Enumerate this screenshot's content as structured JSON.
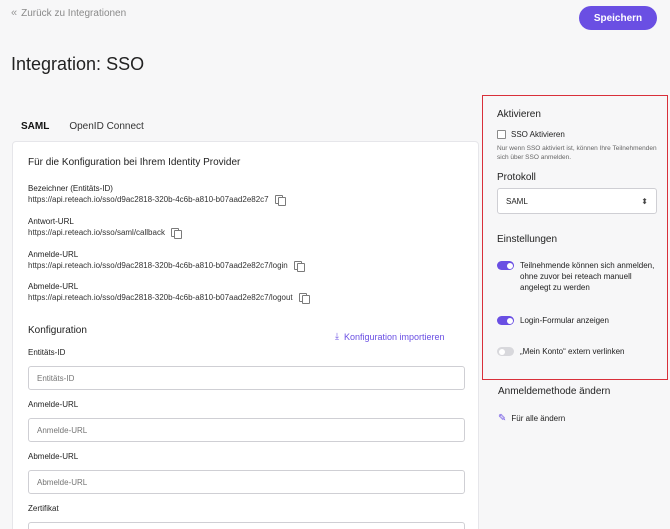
{
  "header": {
    "back_label": "Zurück zu Integrationen",
    "save_label": "Speichern",
    "title": "Integration: SSO"
  },
  "tabs": [
    {
      "label": "SAML",
      "active": true
    },
    {
      "label": "OpenID Connect",
      "active": false
    }
  ],
  "idp": {
    "heading": "Für die Konfiguration bei Ihrem Identity Provider",
    "items": [
      {
        "label": "Bezeichner (Entitäts-ID)",
        "value": "https://api.reteach.io/sso/d9ac2818-320b-4c6b-a810-b07aad2e82c7"
      },
      {
        "label": "Antwort-URL",
        "value": "https://api.reteach.io/sso/saml/callback"
      },
      {
        "label": "Anmelde-URL",
        "value": "https://api.reteach.io/sso/d9ac2818-320b-4c6b-a810-b07aad2e82c7/login"
      },
      {
        "label": "Abmelde-URL",
        "value": "https://api.reteach.io/sso/d9ac2818-320b-4c6b-a810-b07aad2e82c7/logout"
      }
    ]
  },
  "config": {
    "heading": "Konfiguration",
    "import_label": "Konfiguration importieren",
    "fields": [
      {
        "label": "Entitäts-ID",
        "placeholder": "Entitäts-ID",
        "value": ""
      },
      {
        "label": "Anmelde-URL",
        "placeholder": "Anmelde-URL",
        "value": ""
      },
      {
        "label": "Abmelde-URL",
        "placeholder": "Abmelde-URL",
        "value": ""
      },
      {
        "label": "Zertifikat",
        "placeholder": "",
        "value": ""
      }
    ]
  },
  "sidebar": {
    "activate_heading": "Aktivieren",
    "sso_checkbox_label": "SSO Aktivieren",
    "sso_checkbox_checked": false,
    "sso_hint": "Nur wenn SSO aktiviert ist, können Ihre Teilnehmenden sich über SSO anmelden.",
    "protocol_heading": "Protokoll",
    "protocol_value": "SAML",
    "settings_heading": "Einstellungen",
    "toggles": [
      {
        "label": "Teilnehmende können sich anmelden, ohne zuvor bei reteach manuell angelegt zu werden",
        "on": true
      },
      {
        "label": "Login-Formular anzeigen",
        "on": true
      },
      {
        "label": "„Mein Konto“ extern verlinken",
        "on": false
      }
    ],
    "method_heading": "Anmeldemethode ändern",
    "method_link": "Für alle ändern"
  },
  "colors": {
    "accent": "#6a4fe3",
    "highlight_border": "#d9303a"
  }
}
